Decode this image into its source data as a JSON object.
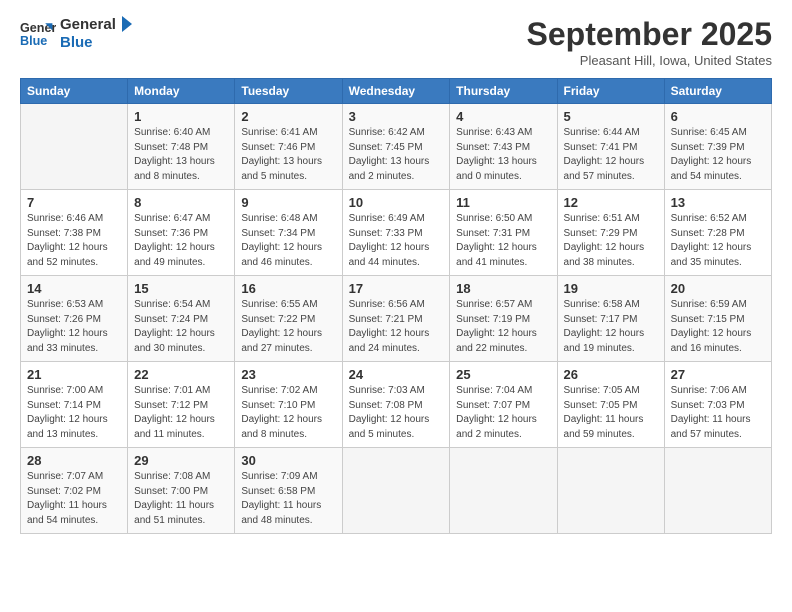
{
  "header": {
    "logo_line1": "General",
    "logo_line2": "Blue",
    "month": "September 2025",
    "location": "Pleasant Hill, Iowa, United States"
  },
  "days_of_week": [
    "Sunday",
    "Monday",
    "Tuesday",
    "Wednesday",
    "Thursday",
    "Friday",
    "Saturday"
  ],
  "weeks": [
    [
      {
        "day": "",
        "info": ""
      },
      {
        "day": "1",
        "info": "Sunrise: 6:40 AM\nSunset: 7:48 PM\nDaylight: 13 hours\nand 8 minutes."
      },
      {
        "day": "2",
        "info": "Sunrise: 6:41 AM\nSunset: 7:46 PM\nDaylight: 13 hours\nand 5 minutes."
      },
      {
        "day": "3",
        "info": "Sunrise: 6:42 AM\nSunset: 7:45 PM\nDaylight: 13 hours\nand 2 minutes."
      },
      {
        "day": "4",
        "info": "Sunrise: 6:43 AM\nSunset: 7:43 PM\nDaylight: 13 hours\nand 0 minutes."
      },
      {
        "day": "5",
        "info": "Sunrise: 6:44 AM\nSunset: 7:41 PM\nDaylight: 12 hours\nand 57 minutes."
      },
      {
        "day": "6",
        "info": "Sunrise: 6:45 AM\nSunset: 7:39 PM\nDaylight: 12 hours\nand 54 minutes."
      }
    ],
    [
      {
        "day": "7",
        "info": "Sunrise: 6:46 AM\nSunset: 7:38 PM\nDaylight: 12 hours\nand 52 minutes."
      },
      {
        "day": "8",
        "info": "Sunrise: 6:47 AM\nSunset: 7:36 PM\nDaylight: 12 hours\nand 49 minutes."
      },
      {
        "day": "9",
        "info": "Sunrise: 6:48 AM\nSunset: 7:34 PM\nDaylight: 12 hours\nand 46 minutes."
      },
      {
        "day": "10",
        "info": "Sunrise: 6:49 AM\nSunset: 7:33 PM\nDaylight: 12 hours\nand 44 minutes."
      },
      {
        "day": "11",
        "info": "Sunrise: 6:50 AM\nSunset: 7:31 PM\nDaylight: 12 hours\nand 41 minutes."
      },
      {
        "day": "12",
        "info": "Sunrise: 6:51 AM\nSunset: 7:29 PM\nDaylight: 12 hours\nand 38 minutes."
      },
      {
        "day": "13",
        "info": "Sunrise: 6:52 AM\nSunset: 7:28 PM\nDaylight: 12 hours\nand 35 minutes."
      }
    ],
    [
      {
        "day": "14",
        "info": "Sunrise: 6:53 AM\nSunset: 7:26 PM\nDaylight: 12 hours\nand 33 minutes."
      },
      {
        "day": "15",
        "info": "Sunrise: 6:54 AM\nSunset: 7:24 PM\nDaylight: 12 hours\nand 30 minutes."
      },
      {
        "day": "16",
        "info": "Sunrise: 6:55 AM\nSunset: 7:22 PM\nDaylight: 12 hours\nand 27 minutes."
      },
      {
        "day": "17",
        "info": "Sunrise: 6:56 AM\nSunset: 7:21 PM\nDaylight: 12 hours\nand 24 minutes."
      },
      {
        "day": "18",
        "info": "Sunrise: 6:57 AM\nSunset: 7:19 PM\nDaylight: 12 hours\nand 22 minutes."
      },
      {
        "day": "19",
        "info": "Sunrise: 6:58 AM\nSunset: 7:17 PM\nDaylight: 12 hours\nand 19 minutes."
      },
      {
        "day": "20",
        "info": "Sunrise: 6:59 AM\nSunset: 7:15 PM\nDaylight: 12 hours\nand 16 minutes."
      }
    ],
    [
      {
        "day": "21",
        "info": "Sunrise: 7:00 AM\nSunset: 7:14 PM\nDaylight: 12 hours\nand 13 minutes."
      },
      {
        "day": "22",
        "info": "Sunrise: 7:01 AM\nSunset: 7:12 PM\nDaylight: 12 hours\nand 11 minutes."
      },
      {
        "day": "23",
        "info": "Sunrise: 7:02 AM\nSunset: 7:10 PM\nDaylight: 12 hours\nand 8 minutes."
      },
      {
        "day": "24",
        "info": "Sunrise: 7:03 AM\nSunset: 7:08 PM\nDaylight: 12 hours\nand 5 minutes."
      },
      {
        "day": "25",
        "info": "Sunrise: 7:04 AM\nSunset: 7:07 PM\nDaylight: 12 hours\nand 2 minutes."
      },
      {
        "day": "26",
        "info": "Sunrise: 7:05 AM\nSunset: 7:05 PM\nDaylight: 11 hours\nand 59 minutes."
      },
      {
        "day": "27",
        "info": "Sunrise: 7:06 AM\nSunset: 7:03 PM\nDaylight: 11 hours\nand 57 minutes."
      }
    ],
    [
      {
        "day": "28",
        "info": "Sunrise: 7:07 AM\nSunset: 7:02 PM\nDaylight: 11 hours\nand 54 minutes."
      },
      {
        "day": "29",
        "info": "Sunrise: 7:08 AM\nSunset: 7:00 PM\nDaylight: 11 hours\nand 51 minutes."
      },
      {
        "day": "30",
        "info": "Sunrise: 7:09 AM\nSunset: 6:58 PM\nDaylight: 11 hours\nand 48 minutes."
      },
      {
        "day": "",
        "info": ""
      },
      {
        "day": "",
        "info": ""
      },
      {
        "day": "",
        "info": ""
      },
      {
        "day": "",
        "info": ""
      }
    ]
  ]
}
